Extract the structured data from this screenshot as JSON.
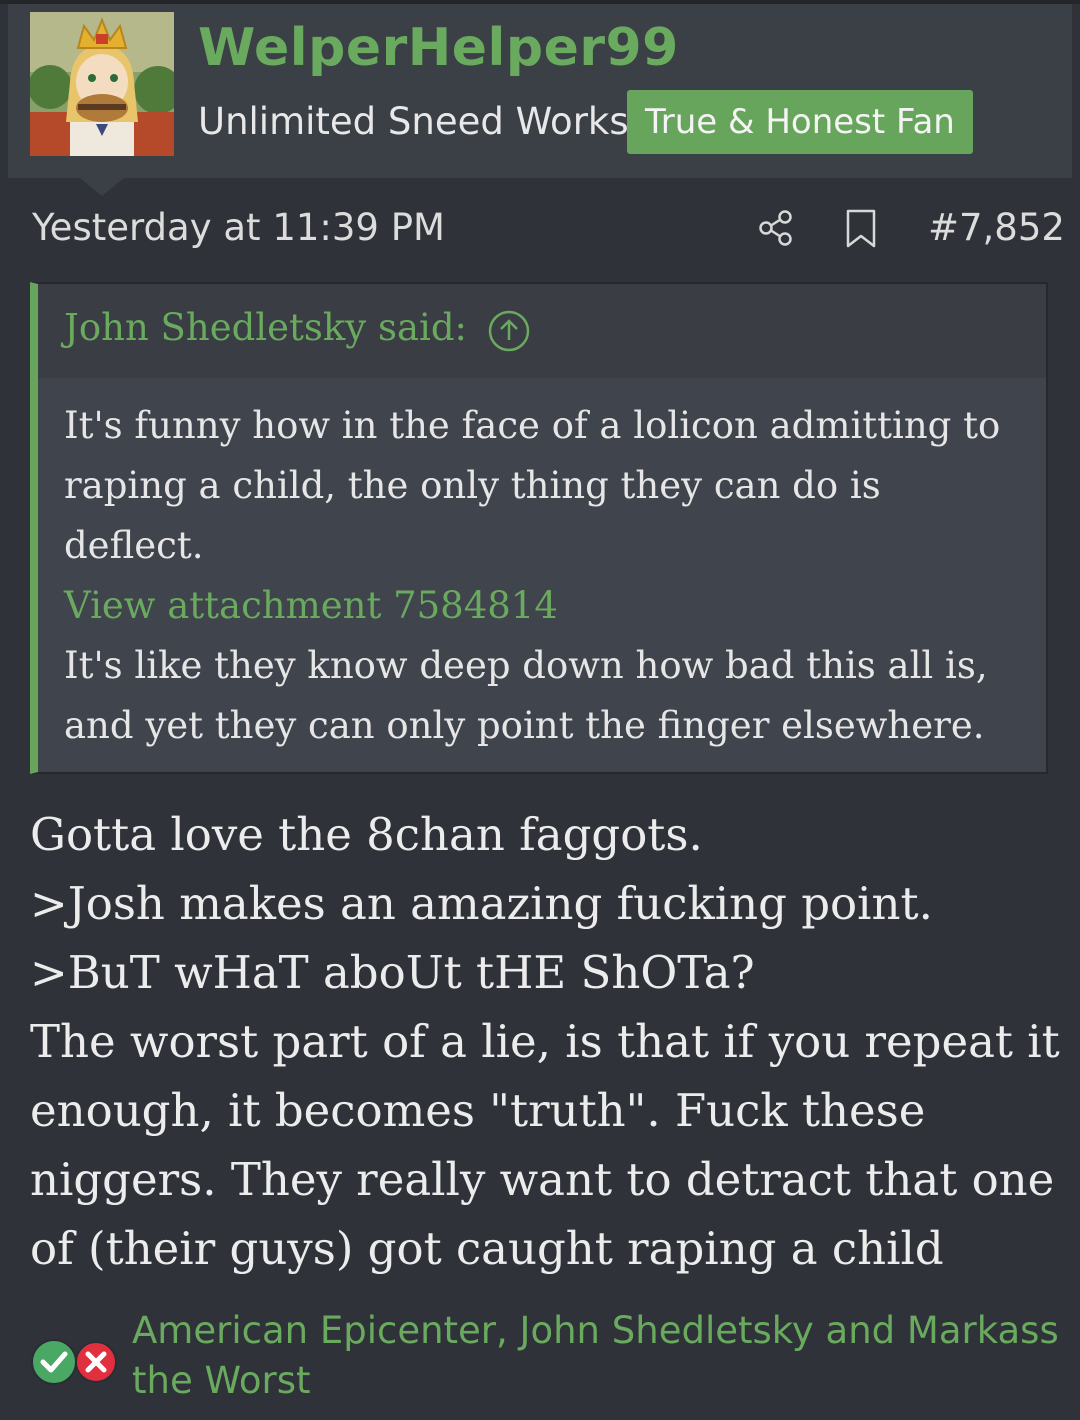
{
  "user": {
    "name": "WelperHelper99",
    "title": "Unlimited Sneed Works",
    "banner": "True & Honest Fan"
  },
  "post": {
    "date": "Yesterday at 11:39 PM",
    "number": "#7,852",
    "icons": {
      "share": "share-icon",
      "bookmark": "bookmark-icon"
    }
  },
  "quote": {
    "author_line": "John Shedletsky said:",
    "jump_icon": "arrow-up-circle-icon",
    "lines": [
      "It's funny how in the face of a lolicon admitting to",
      "raping a child, the only thing they can do is",
      "deflect.",
      "View attachment 7584814",
      "It's like they know deep down how bad this all is,",
      "and yet they can only point the finger elsewhere."
    ]
  },
  "body_lines": [
    "Gotta love the 8chan faggots.",
    ">Josh makes an amazing fucking point.",
    ">BuT wHaT aboUt tHE ShOTa?",
    "The worst part of a lie, is that if you repeat it",
    "enough, it becomes \"truth\". Fuck these",
    "niggers. They really want to detract that one",
    "of (their guys) got caught raping a child"
  ],
  "reactions": {
    "icons": [
      "check-icon",
      "cross-icon"
    ],
    "line1": "American Epicenter, John Shedletsky and Markass",
    "line2": "the Worst"
  },
  "colors": {
    "accent": "#6aaa5f",
    "banner": "#67a55d",
    "background": "#2f3238",
    "header": "#3b3f46",
    "quote_bg": "#40444c"
  }
}
